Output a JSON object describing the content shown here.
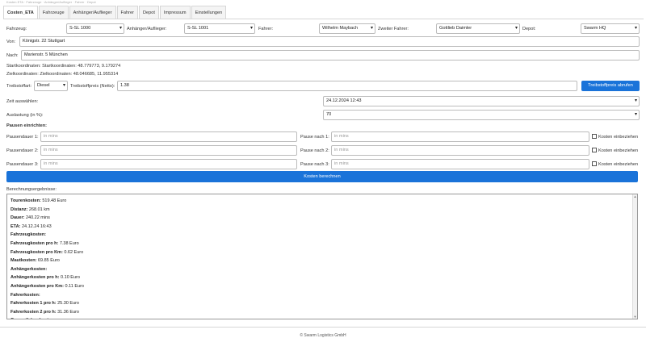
{
  "top_strip": "Kosten ETA · Fahrzeuge · Anhänger/Auflieger · Fahrer · Depot",
  "tabs": [
    "Costen_ETA",
    "Fahrzeuge",
    "Anhänger/Auflieger",
    "Fahrer",
    "Depot",
    "Impressum",
    "Einstellungen"
  ],
  "selectors": {
    "fahrzeug_label": "Fahrzeug:",
    "fahrzeug_value": "S-SL 1000",
    "anhaenger_label": "Anhänger/Auflieger:",
    "anhaenger_value": "S-SL 1001",
    "fahrer_label": "Fahrer:",
    "fahrer_value": "Wilhelm Maybach",
    "zweiter_label": "Zweiter Fahrer:",
    "zweiter_value": "Gottlieb Daimler",
    "depot_label": "Depot:",
    "depot_value": "Swarm HQ"
  },
  "route": {
    "von_label": "Von:",
    "von_value": "Königstr. 22 Stuttgart",
    "nach_label": "Nach:",
    "nach_value": "Marienstr. 5 München",
    "start_coords": "Startkoordinaten: Startkoordinaten: 48.779773, 9.179274",
    "ziel_coords": "Zielkoordinaten:   Zielkoordinaten: 48.046685, 11.955314"
  },
  "fuel": {
    "art_label": "Treibstoffart:",
    "art_value": "Diesel",
    "preis_label": "Treibstoffpreis (Netto):",
    "preis_value": "1.38",
    "button": "Treibstoffpreis abrufen"
  },
  "time": {
    "label": "Zeit auswählen:",
    "value": "24.12.2024 12:43"
  },
  "load": {
    "label": "Auslastung (in %):",
    "value": "70"
  },
  "pauses": {
    "heading": "Pausen einrichten:",
    "rows": [
      {
        "dauer_label": "Pausendauer 1:",
        "dauer_ph": "in mins",
        "nach_label": "Pause nach 1:",
        "nach_ph": "in mins",
        "cb_label": "Kosten einbeziehen"
      },
      {
        "dauer_label": "Pausendauer 2:",
        "dauer_ph": "in mins",
        "nach_label": "Pause nach 2:",
        "nach_ph": "in mins",
        "cb_label": "Kosten einbeziehen"
      },
      {
        "dauer_label": "Pausendauer 3:",
        "dauer_ph": "in mins",
        "nach_label": "Pause nach 3:",
        "nach_ph": "in mins",
        "cb_label": "Kosten einbeziehen"
      }
    ]
  },
  "calc_button": "Kosten berechnen",
  "results": {
    "label": "Berechnungsergebnisse:",
    "lines": [
      {
        "k": "Tourenkosten:",
        "v": "519.48 Euro"
      },
      {
        "k": "Distanz:",
        "v": "268.01 km"
      },
      {
        "k": "Dauer:",
        "v": "240.22 mins"
      },
      {
        "k": "ETA:",
        "v": "24.12.24 16:43"
      },
      {
        "k": "Fahrzeugkosten:",
        "v": ""
      },
      {
        "k": "Fahrzeugkosten pro h:",
        "v": "7.38 Euro"
      },
      {
        "k": "Fahrzeugkosten pro Km:",
        "v": "0.62 Euro"
      },
      {
        "k": "Mautkosten:",
        "v": "69.85 Euro"
      },
      {
        "k": "Anhängerkosten:",
        "v": ""
      },
      {
        "k": "Anhängerkosten pro h:",
        "v": "0.10 Euro"
      },
      {
        "k": "Anhängerkosten pro Km:",
        "v": "0.11 Euro"
      },
      {
        "k": "Fahrerkosten:",
        "v": ""
      },
      {
        "k": "Fahrerkosten 1 pro h:",
        "v": "25.30 Euro"
      },
      {
        "k": "Fahrerkosten 2 pro h:",
        "v": "31.36 Euro"
      },
      {
        "k": "Gesamtfahrerkosten:",
        "v": ""
      }
    ]
  },
  "footer": "© Swarm Logistics GmbH"
}
